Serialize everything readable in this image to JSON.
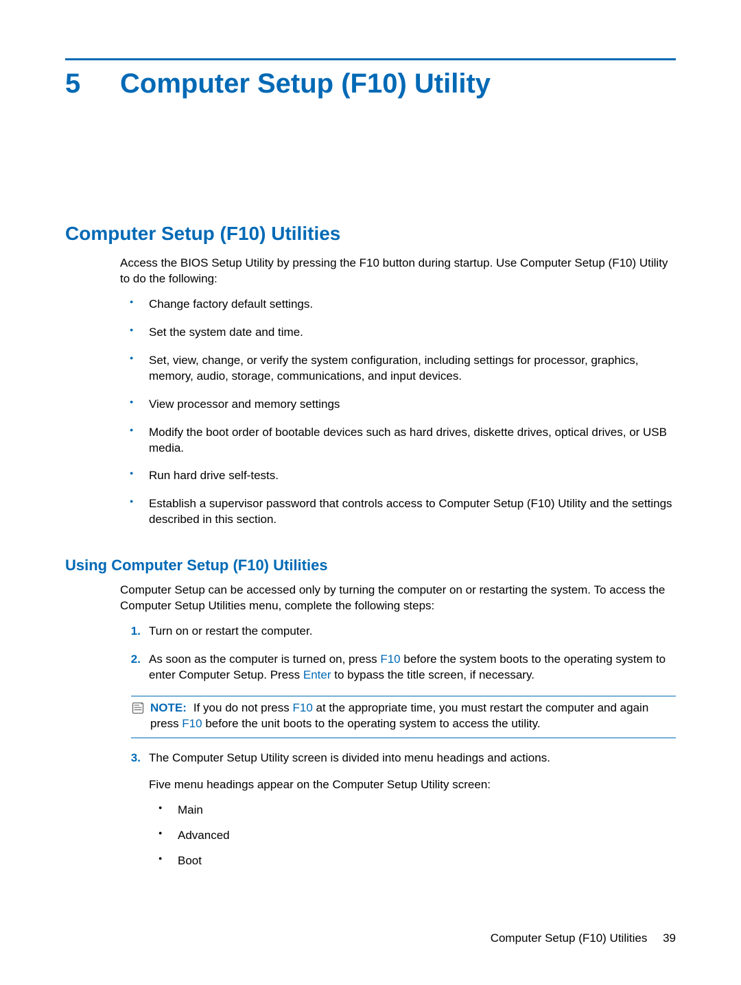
{
  "chapter": {
    "number": "5",
    "title": "Computer Setup (F10) Utility"
  },
  "section": {
    "title": "Computer Setup (F10) Utilities",
    "intro": "Access the BIOS Setup Utility by pressing the F10 button during startup. Use Computer Setup (F10) Utility to do the following:",
    "bullets": [
      "Change factory default settings.",
      "Set the system date and time.",
      "Set, view, change, or verify the system configuration, including settings for processor, graphics, memory, audio, storage, communications, and input devices.",
      "View processor and memory settings",
      "Modify the boot order of bootable devices such as hard drives, diskette drives, optical drives, or USB media.",
      "Run hard drive self-tests.",
      "Establish a supervisor password that controls access to Computer Setup (F10) Utility and the settings described in this section."
    ]
  },
  "subsection": {
    "title": "Using Computer Setup (F10) Utilities",
    "intro": "Computer Setup can be accessed only by turning the computer on or restarting the system. To access the Computer Setup Utilities menu, complete the following steps:",
    "steps": {
      "s1": "Turn on or restart the computer.",
      "s2_a": "As soon as the computer is turned on, press ",
      "s2_key1": "F10",
      "s2_b": " before the system boots to the operating system to enter Computer Setup. Press ",
      "s2_key2": "Enter",
      "s2_c": " to bypass the title screen, if necessary.",
      "s3_a": "The Computer Setup Utility screen is divided into menu headings and actions.",
      "s3_b": "Five menu headings appear on the Computer Setup Utility screen:"
    },
    "note": {
      "label": "NOTE:",
      "a": "If you do not press ",
      "key1": "F10",
      "b": " at the appropriate time, you must restart the computer and again press ",
      "key2": "F10",
      "c": " before the unit boots to the operating system to access the utility."
    },
    "menu_headings": [
      "Main",
      "Advanced",
      "Boot"
    ]
  },
  "footer": {
    "section_name": "Computer Setup (F10) Utilities",
    "page_number": "39"
  }
}
